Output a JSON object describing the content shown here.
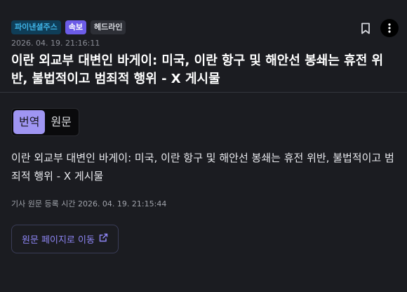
{
  "header": {
    "tags": {
      "source": "파이낸셜주스",
      "breaking": "속보",
      "headline": "헤드라인"
    },
    "timestamp": "2026. 04. 19. 21:16:11",
    "title": "이란 외교부 대변인 바게이: 미국, 이란 항구 및 해안선 봉쇄는 휴전 위반, 불법적이고 범죄적 행위 - X 게시물",
    "icons": {
      "bookmark": "bookmark-icon",
      "more": "more-vertical-icon"
    }
  },
  "toggle": {
    "translation": "번역",
    "original": "원문",
    "selected": "translation"
  },
  "article": {
    "content": "이란 외교부 대변인 바게이: 미국, 이란 항구 및 해안선 봉쇄는 휴전 위반, 불법적이고 범죄적 행위 - X 게시물",
    "registered_label": "기사 원문 등록 시간 2026. 04. 19. 21:15:44",
    "origin_button": "원문 페이지로 이동",
    "origin_icon": "external-link-icon"
  },
  "colors": {
    "accent": "#9f95f2",
    "link": "#8e86f5",
    "source_tag": "#3fb3e6",
    "breaking_tag": "#6c5ce7"
  }
}
